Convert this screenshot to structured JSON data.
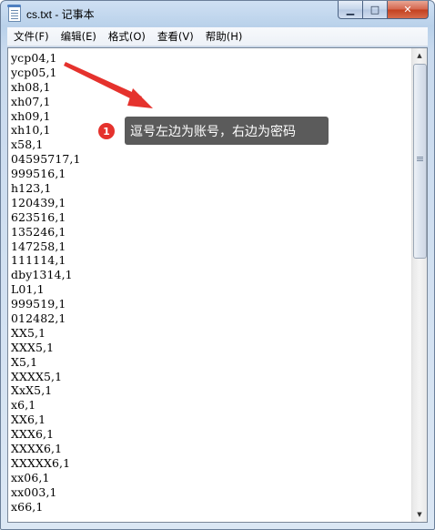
{
  "window": {
    "title": "cs.txt - 记事本"
  },
  "controls": {
    "minimize": "▁",
    "maximize": "□",
    "close": "✕"
  },
  "menu": [
    "文件(F)",
    "编辑(E)",
    "格式(O)",
    "查看(V)",
    "帮助(H)"
  ],
  "lines": [
    "ycp04,1",
    "ycp05,1",
    "xh08,1",
    "xh07,1",
    "xh09,1",
    "xh10,1",
    "x58,1",
    "04595717,1",
    "999516,1",
    "h123,1",
    "120439,1",
    "623516,1",
    "135246,1",
    "147258,1",
    "111114,1",
    "dby1314,1",
    "L01,1",
    "999519,1",
    "012482,1",
    "XX5,1",
    "XXX5,1",
    "X5,1",
    "XXXX5,1",
    "XxX5,1",
    "x6,1",
    "XX6,1",
    "XXX6,1",
    "XXXX6,1",
    "XXXXX6,1",
    "xx06,1",
    "xx003,1",
    "x66,1"
  ],
  "annotation": {
    "badge": "1",
    "text": "逗号左边为账号，右边为密码"
  },
  "scrollbar": {
    "up": "▲",
    "down": "▼"
  },
  "colors": {
    "badge": "#e5322d",
    "callout_bg": "#5b5b5b",
    "arrow": "#e5322d"
  }
}
